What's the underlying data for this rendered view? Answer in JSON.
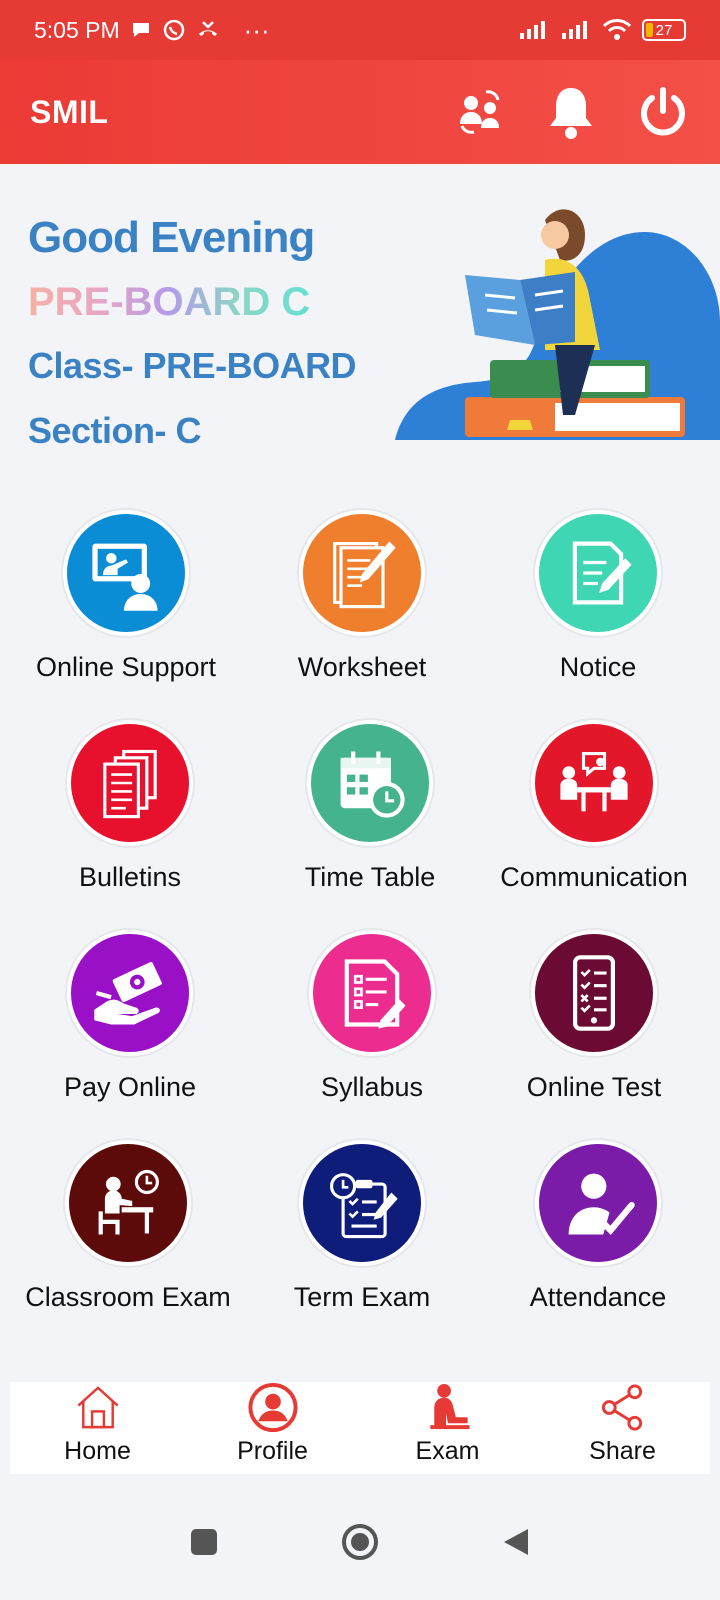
{
  "status": {
    "time": "5:05 PM",
    "dots": "···",
    "battery": "27"
  },
  "appbar": {
    "title": "SMIL",
    "icons": [
      "switch-user-icon",
      "bell-icon",
      "power-icon"
    ]
  },
  "hero": {
    "greeting": "Good Evening",
    "student_name": "PRE-BOARD C",
    "class_text": "Class- PRE-BOARD",
    "section_text": "Section- C"
  },
  "tiles": [
    {
      "label": "Online Support",
      "color": "#0b8dd6",
      "icon": "online-support-icon"
    },
    {
      "label": "Worksheet",
      "color": "#f07f2d",
      "icon": "worksheet-icon"
    },
    {
      "label": "Notice",
      "color": "#3fd6b4",
      "icon": "notice-icon"
    },
    {
      "label": "Bulletins",
      "color": "#e8112d",
      "icon": "bulletins-icon"
    },
    {
      "label": "Time Table",
      "color": "#46b38f",
      "icon": "time-table-icon"
    },
    {
      "label": "Communication",
      "color": "#e3162a",
      "icon": "communication-icon"
    },
    {
      "label": "Pay Online",
      "color": "#9a10c6",
      "icon": "pay-online-icon"
    },
    {
      "label": "Syllabus",
      "color": "#ec2c8f",
      "icon": "syllabus-icon"
    },
    {
      "label": "Online Test",
      "color": "#6b0b34",
      "icon": "online-test-icon"
    },
    {
      "label": "Classroom Exam",
      "color": "#5c0a0a",
      "icon": "classroom-exam-icon"
    },
    {
      "label": "Term Exam",
      "color": "#0f1d7a",
      "icon": "term-exam-icon"
    },
    {
      "label": "Attendance",
      "color": "#7b1ca8",
      "icon": "attendance-icon"
    }
  ],
  "bottom_nav": [
    {
      "label": "Home",
      "icon": "home-icon"
    },
    {
      "label": "Profile",
      "icon": "profile-icon"
    },
    {
      "label": "Exam",
      "icon": "exam-icon"
    },
    {
      "label": "Share",
      "icon": "share-icon"
    }
  ],
  "colors": {
    "primary": "#e63a35",
    "heading": "#3a82c4"
  }
}
